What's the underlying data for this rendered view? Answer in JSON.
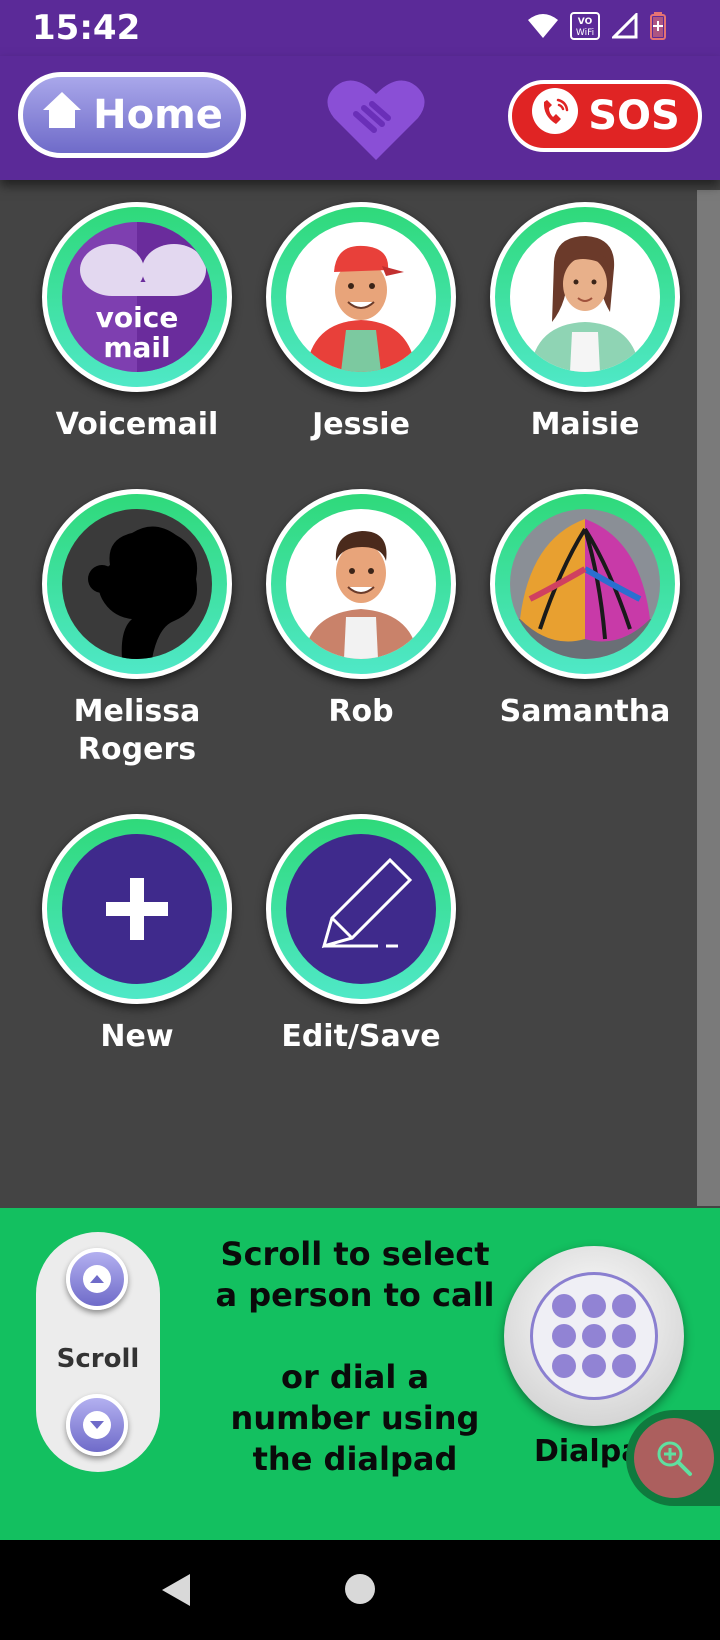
{
  "status_bar": {
    "time": "15:42",
    "volte_label": "VO\nWiFi"
  },
  "header": {
    "home_label": "Home",
    "sos_label": "SOS"
  },
  "contacts": [
    {
      "name": "Voicemail",
      "avatar": "voicemail-icon",
      "avatar_text": "voice mail"
    },
    {
      "name": "Jessie",
      "avatar": "man-cap-illustration"
    },
    {
      "name": "Maisie",
      "avatar": "woman-illustration"
    },
    {
      "name": "Melissa Rogers",
      "avatar": "silhouette-photo"
    },
    {
      "name": "Rob",
      "avatar": "man-illustration"
    },
    {
      "name": "Samantha",
      "avatar": "butterfly-wings-photo"
    },
    {
      "name": "New",
      "avatar": "plus-icon"
    },
    {
      "name": "Edit/Save",
      "avatar": "pencil-icon"
    }
  ],
  "bottom_panel": {
    "scroll_label": "Scroll",
    "instructions_line1": "Scroll to select a person to call",
    "instructions_line2": "or dial a number using the dialpad",
    "dialpad_label": "Dialpad"
  },
  "colors": {
    "brand_purple": "#5b2a98",
    "accent_green": "#13c060",
    "sos_red": "#e02424"
  }
}
